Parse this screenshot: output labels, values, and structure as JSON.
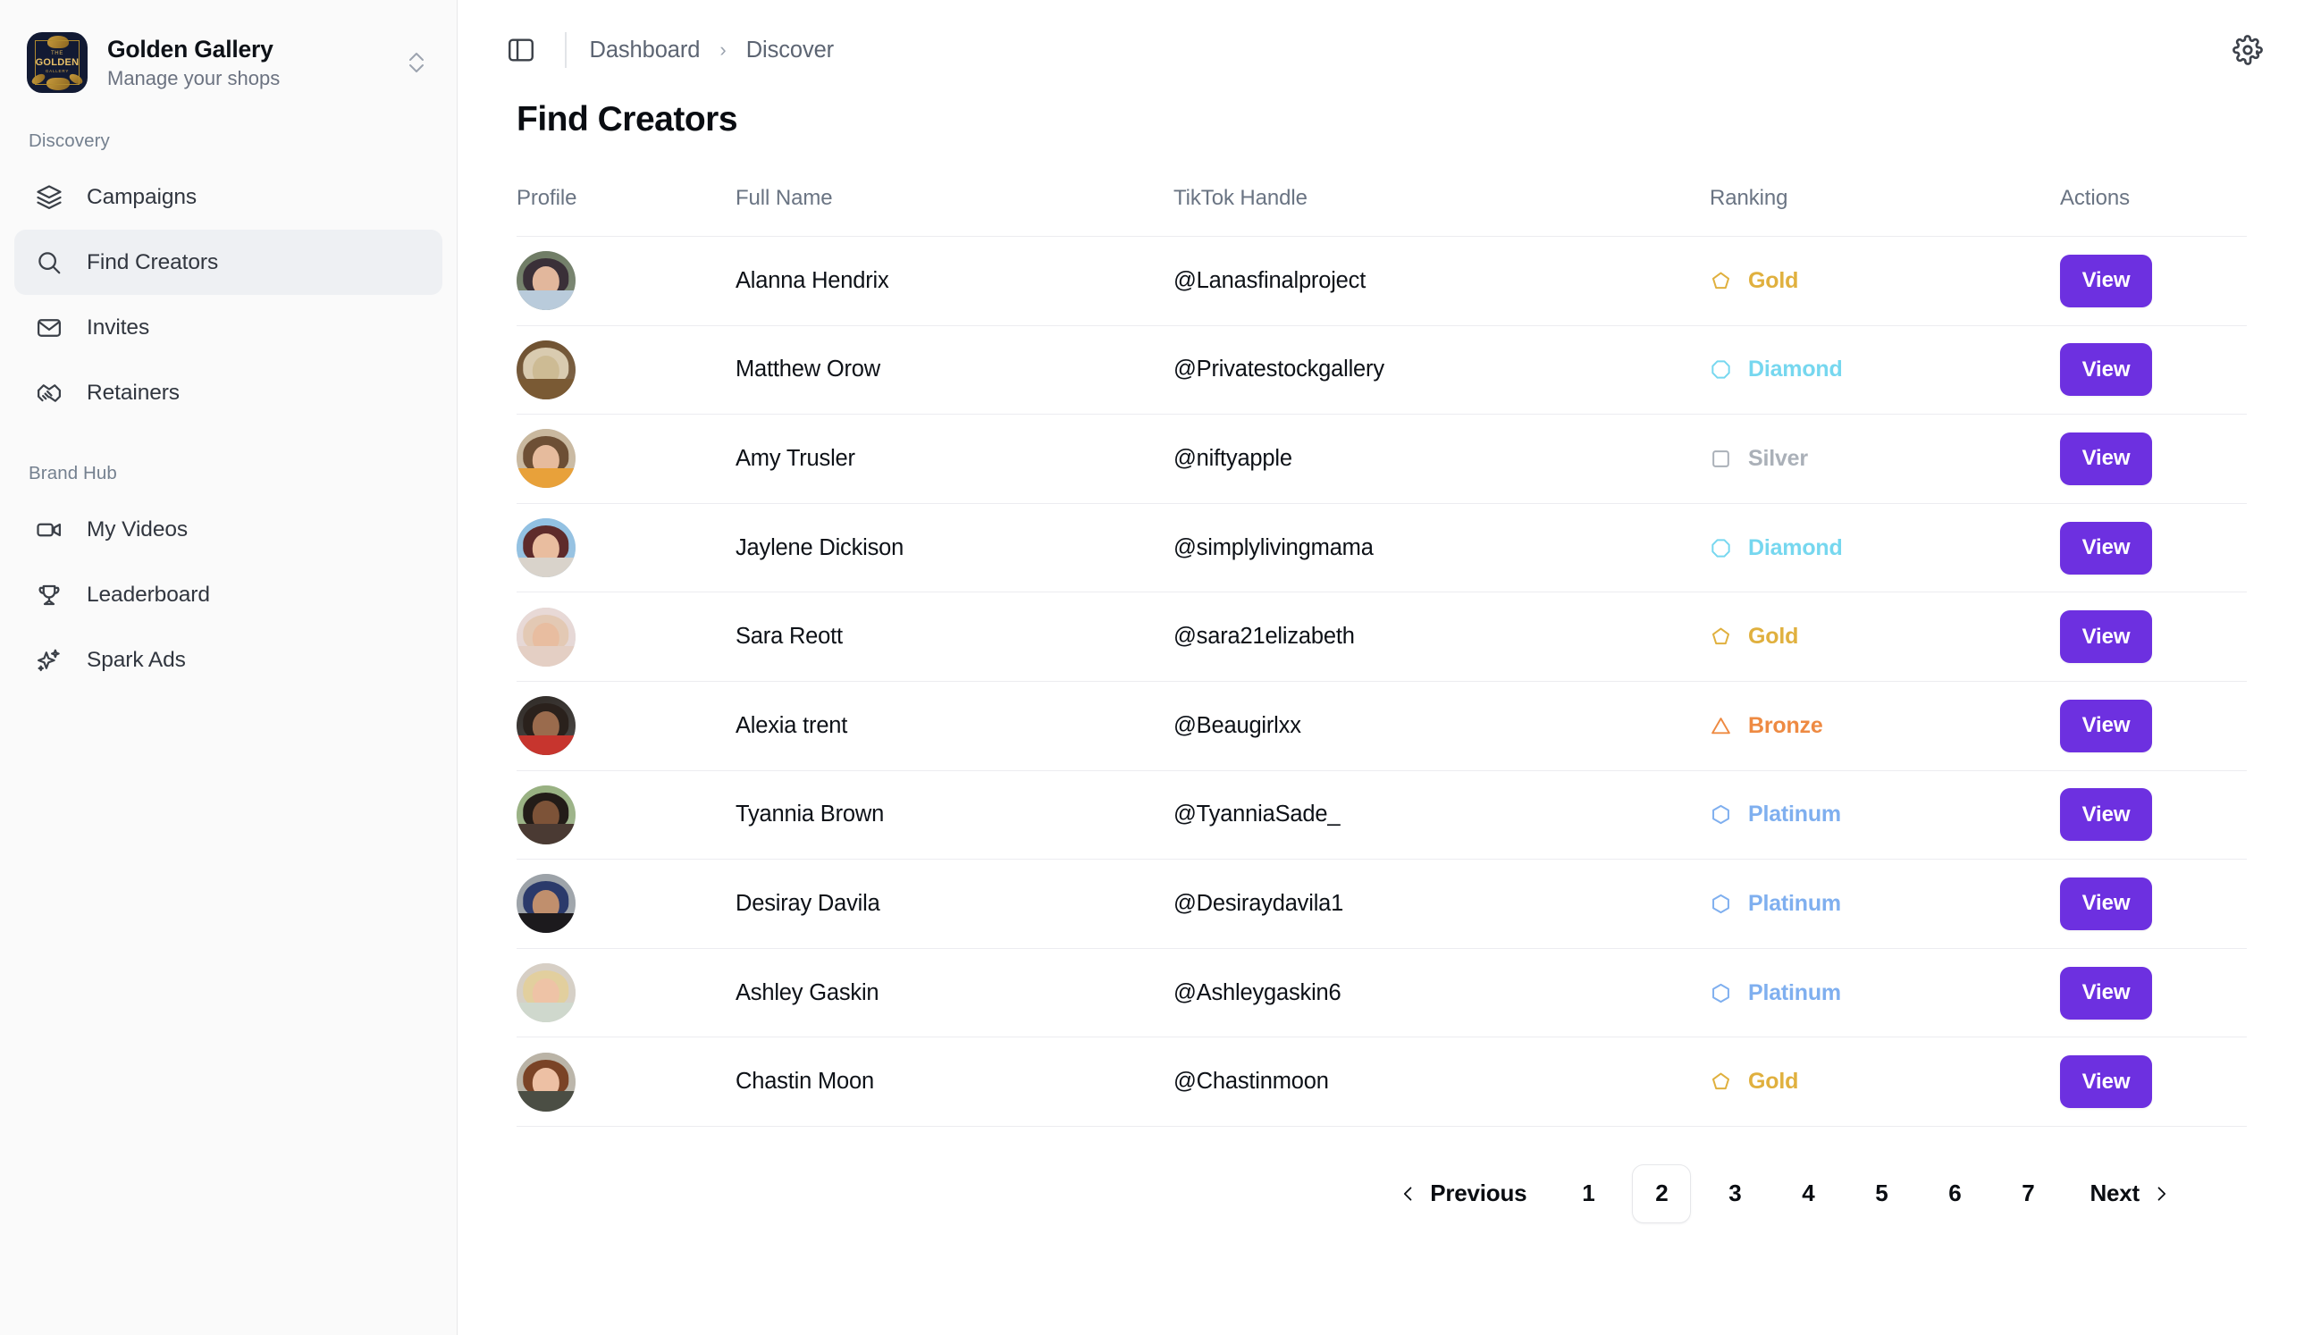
{
  "sidebar": {
    "brand": {
      "name": "Golden Gallery",
      "subtitle": "Manage your shops",
      "logo_line1": "THE",
      "logo_line2": "GOLDEN",
      "logo_line3": "GALLERY",
      "switcher_icon": "chevron-up-down-icon"
    },
    "groups": [
      {
        "label": "Discovery",
        "items": [
          {
            "label": "Campaigns",
            "icon": "layers-icon",
            "active": false
          },
          {
            "label": "Find Creators",
            "icon": "search-icon",
            "active": true
          },
          {
            "label": "Invites",
            "icon": "envelope-icon",
            "active": false
          },
          {
            "label": "Retainers",
            "icon": "handshake-icon",
            "active": false
          }
        ]
      },
      {
        "label": "Brand Hub",
        "items": [
          {
            "label": "My Videos",
            "icon": "video-camera-icon",
            "active": false
          },
          {
            "label": "Leaderboard",
            "icon": "trophy-icon",
            "active": false
          },
          {
            "label": "Spark Ads",
            "icon": "sparkles-icon",
            "active": false
          }
        ]
      }
    ]
  },
  "topbar": {
    "panel_toggle_icon": "sidebar-panel-icon",
    "breadcrumb": [
      "Dashboard",
      "Discover"
    ],
    "breadcrumb_separator": "›",
    "settings_icon": "gear-icon"
  },
  "page": {
    "title": "Find Creators"
  },
  "table": {
    "columns": [
      "Profile",
      "Full Name",
      "TikTok Handle",
      "Ranking",
      "Actions"
    ],
    "action_label": "View",
    "rows": [
      {
        "name": "Alanna Hendrix",
        "handle": "@Lanasfinalproject",
        "rank": "Gold",
        "avatar": {
          "sky": "#6d7a62",
          "hair": "#3a3038",
          "face": "#e2b79c",
          "body": "#b9cbdb"
        }
      },
      {
        "name": "Matthew Orow",
        "handle": "@Privatestockgallery",
        "rank": "Diamond",
        "avatar": {
          "sky": "#6d4e2c",
          "hair": "#d9cbb0",
          "face": "#cdbb94",
          "body": "#7a5a34"
        }
      },
      {
        "name": "Amy Trusler",
        "handle": "@niftyapple",
        "rank": "Silver",
        "avatar": {
          "sky": "#c9b79c",
          "hair": "#6d4f35",
          "face": "#e6bb9d",
          "body": "#e8a13a"
        }
      },
      {
        "name": "Jaylene Dickison",
        "handle": "@simplylivingmama",
        "rank": "Diamond",
        "avatar": {
          "sky": "#8fc0e3",
          "hair": "#5e2b2b",
          "face": "#e9bd9f",
          "body": "#d9d3cb"
        }
      },
      {
        "name": "Sara Reott",
        "handle": "@sara21elizabeth",
        "rank": "Gold",
        "avatar": {
          "sky": "#e9d9d6",
          "hair": "#e3c9b4",
          "face": "#e8bda0",
          "body": "#e4cfc4"
        }
      },
      {
        "name": "Alexia trent",
        "handle": "@Beaugirlxx",
        "rank": "Bronze",
        "avatar": {
          "sky": "#2f2a26",
          "hair": "#2a211c",
          "face": "#9a6b4d",
          "body": "#c7352e"
        }
      },
      {
        "name": "Tyannia Brown",
        "handle": "@TyanniaSade_",
        "rank": "Platinum",
        "avatar": {
          "sky": "#97b07f",
          "hair": "#231c18",
          "face": "#7d5338",
          "body": "#4a3a33"
        }
      },
      {
        "name": "Desiray Davila",
        "handle": "@Desiraydavila1",
        "rank": "Platinum",
        "avatar": {
          "sky": "#9aa0a6",
          "hair": "#2b3a6b",
          "face": "#c08f6d",
          "body": "#1c1a1d"
        }
      },
      {
        "name": "Ashley Gaskin",
        "handle": "@Ashleygaskin6",
        "rank": "Platinum",
        "avatar": {
          "sky": "#d7cfc4",
          "hair": "#e2cf9e",
          "face": "#eec3a6",
          "body": "#cfd8cd"
        }
      },
      {
        "name": "Chastin Moon",
        "handle": "@Chastinmoon",
        "rank": "Gold",
        "avatar": {
          "sky": "#b9b2a4",
          "hair": "#7a4326",
          "face": "#edc0a4",
          "body": "#4b4e44"
        }
      }
    ]
  },
  "rank_styles": {
    "Gold": {
      "color": "#e0b03e",
      "shape": "pentagon"
    },
    "Diamond": {
      "color": "#76d7ef",
      "shape": "octagon"
    },
    "Silver": {
      "color": "#aab0b8",
      "shape": "square"
    },
    "Bronze": {
      "color": "#ee8a42",
      "shape": "triangle"
    },
    "Platinum": {
      "color": "#7fafef",
      "shape": "hexagon"
    }
  },
  "pagination": {
    "previous_label": "Previous",
    "next_label": "Next",
    "pages": [
      "1",
      "2",
      "3",
      "4",
      "5",
      "6",
      "7"
    ],
    "current_page": "2",
    "prev_icon": "chevron-left-icon",
    "next_icon": "chevron-right-icon"
  },
  "colors": {
    "accent": "#6d30e0",
    "sidebar_bg": "#fafafa",
    "active_item_bg": "#eef0f3",
    "border": "#ececf0"
  }
}
